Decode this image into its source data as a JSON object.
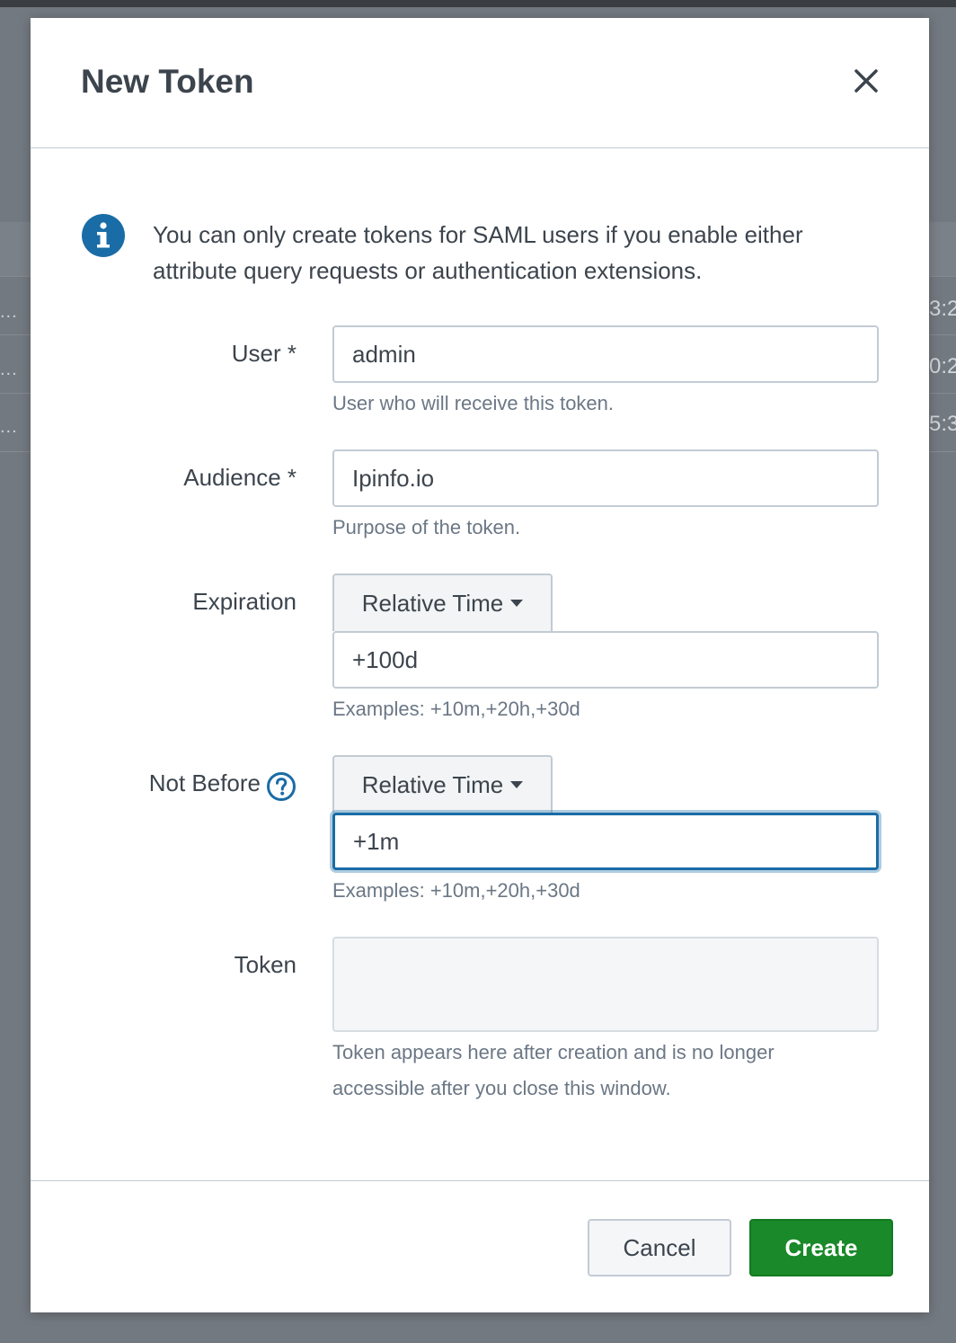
{
  "background": {
    "left_row_marks": [
      "...",
      "...",
      "..."
    ],
    "right_row_marks": [
      "3:2",
      "0:2",
      "5:3"
    ]
  },
  "modal": {
    "title": "New Token",
    "info_message": "You can only create tokens for SAML users if you enable either attribute query requests or authentication extensions.",
    "fields": {
      "user": {
        "label": "User *",
        "value": "admin",
        "help": "User who will receive this token."
      },
      "audience": {
        "label": "Audience *",
        "value": "Ipinfo.io",
        "help": "Purpose of the token."
      },
      "expiration": {
        "label": "Expiration",
        "mode": "Relative Time",
        "value": "+100d",
        "help": "Examples: +10m,+20h,+30d"
      },
      "not_before": {
        "label": "Not Before",
        "mode": "Relative Time",
        "value": "+1m",
        "help": "Examples: +10m,+20h,+30d"
      },
      "token": {
        "label": "Token",
        "value": "",
        "help": "Token appears here after creation and is no longer accessible after you close this window."
      }
    },
    "buttons": {
      "cancel": "Cancel",
      "create": "Create"
    }
  },
  "colors": {
    "primary_green": "#1a8929",
    "info_blue": "#1a6ca6",
    "focus_blue": "#1a6ca6",
    "overlay": "#737980"
  },
  "icons": {
    "close": "close-icon",
    "info": "info-icon",
    "help": "question-circle-icon",
    "caret": "caret-down-icon"
  }
}
